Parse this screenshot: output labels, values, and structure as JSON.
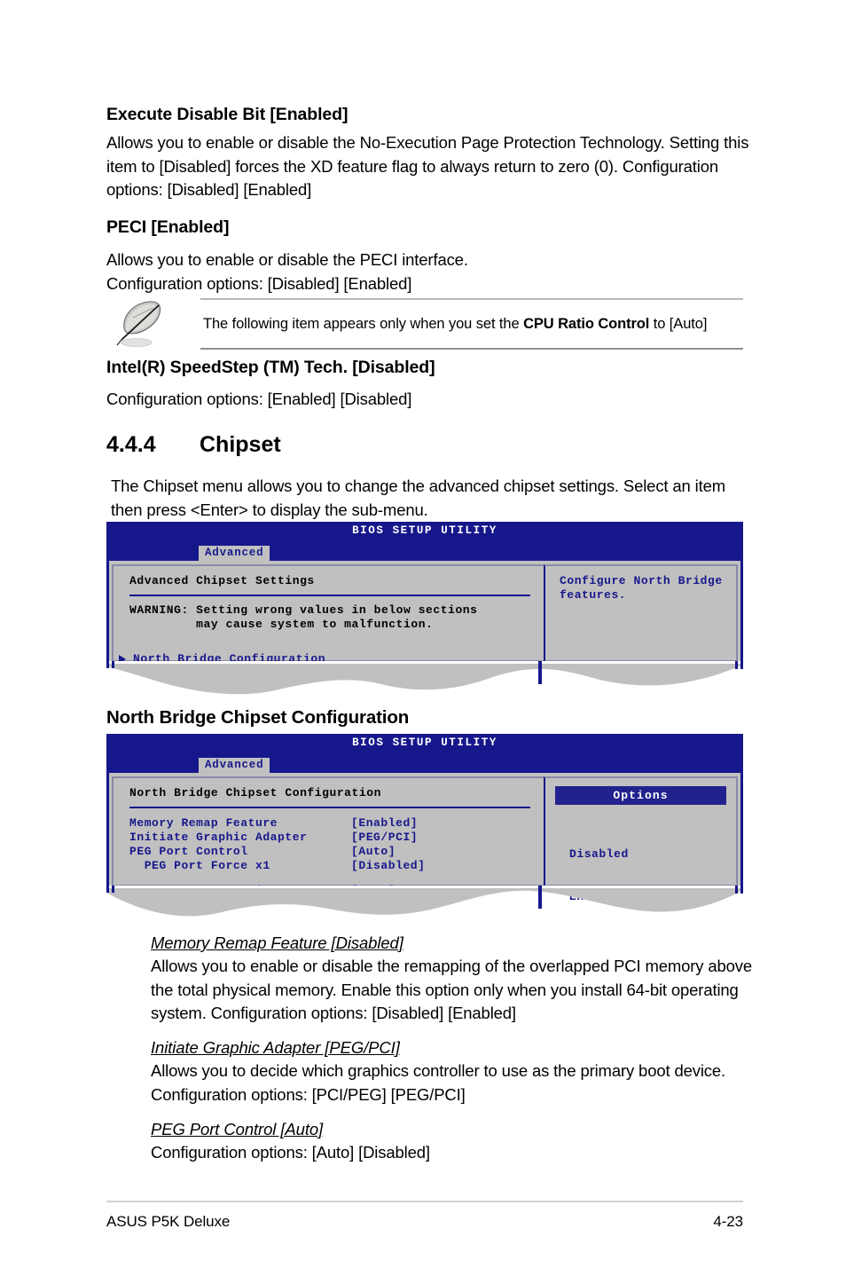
{
  "sections": {
    "execute_disable": {
      "heading": "Execute Disable Bit [Enabled]",
      "paragraph": "Allows you to enable or disable the No-Execution Page Protection Technology. Setting this item to [Disabled] forces the XD feature flag to always return to zero (0). Configuration options: [Disabled] [Enabled]"
    },
    "peci": {
      "heading": "PECI [Enabled]",
      "line1": "Allows you to enable or disable the PECI interface.",
      "line2": "Configuration options: [Disabled] [Enabled]"
    },
    "note": {
      "icon": "quill-pen-icon",
      "text_before": "The following item appears only when you set the ",
      "text_bold": "CPU Ratio Control",
      "text_after": " to [Auto]"
    },
    "speedstep": {
      "heading": "Intel(R) SpeedStep (TM) Tech. [Disabled]",
      "line1": "Configuration options: [Enabled] [Disabled]"
    },
    "chipset": {
      "number": "4.4.4",
      "title": "Chipset",
      "paragraph": "The Chipset menu allows you to change the advanced chipset settings. Select an item then press <Enter> to display the sub-menu."
    },
    "north_bridge_heading": "North Bridge Chipset Configuration"
  },
  "bios_screen_1": {
    "title": "BIOS SETUP UTILITY",
    "tab": "Advanced",
    "panel_heading": "Advanced Chipset Settings",
    "warning_line1": "WARNING: Setting wrong values in below sections",
    "warning_line2": "         may cause system to malfunction.",
    "nav_item": "North Bridge Configuration",
    "help_line1": "Configure North Bridge",
    "help_line2": "features."
  },
  "bios_screen_2": {
    "title": "BIOS SETUP UTILITY",
    "tab": "Advanced",
    "panel_heading": "North Bridge Chipset Configuration",
    "options_header": "Options",
    "options": [
      "Disabled",
      "Enabled"
    ],
    "settings": [
      {
        "name": "Memory Remap Feature",
        "value": "[Enabled]",
        "indent": false,
        "gap_after": false
      },
      {
        "name": "Initiate Graphic Adapter",
        "value": "[PEG/PCI]",
        "indent": false,
        "gap_after": false
      },
      {
        "name": "PEG Port Control",
        "value": "[Auto]",
        "indent": false,
        "gap_after": false
      },
      {
        "name": "  PEG Port Force x1",
        "value": "[Disabled]",
        "indent": true,
        "gap_after": true
      },
      {
        "name": "ASUS C.G.I. Function",
        "value": "[Auto]",
        "indent": false,
        "gap_after": false
      }
    ]
  },
  "items": [
    {
      "title": "Memory Remap Feature [Disabled]",
      "desc": "Allows you to enable or disable the remapping of the overlapped PCI memory above the total physical memory. Enable this option only when you install 64-bit operating system. Configuration options: [Disabled] [Enabled]"
    },
    {
      "title": "Initiate Graphic Adapter [PEG/PCI]",
      "desc": "Allows you to decide which graphics controller to use as the primary boot device. Configuration options: [PCI/PEG] [PEG/PCI]"
    },
    {
      "title": "PEG Port Control [Auto]",
      "desc": "Configuration options: [Auto] [Disabled]"
    }
  ],
  "footer": {
    "left": "ASUS P5K Deluxe",
    "right": "4-23"
  },
  "colors": {
    "bios_blue": "#17178c",
    "bios_gray": "#c0c0c0",
    "tab_gray": "#c0c0c0",
    "options_bar": "#22228e"
  }
}
